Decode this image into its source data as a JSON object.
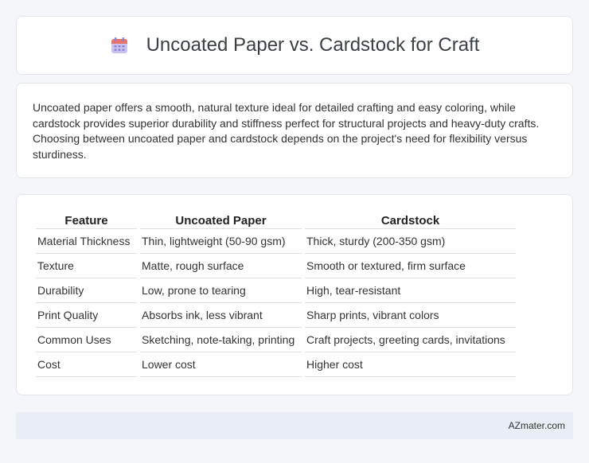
{
  "header": {
    "icon": "calendar-icon",
    "title": "Uncoated Paper vs. Cardstock for Craft"
  },
  "summary": {
    "text": "Uncoated paper offers a smooth, natural texture ideal for detailed crafting and easy coloring, while cardstock provides superior durability and stiffness perfect for structural projects and heavy-duty crafts. Choosing between uncoated paper and cardstock depends on the project's need for flexibility versus sturdiness."
  },
  "table": {
    "headers": [
      "Feature",
      "Uncoated Paper",
      "Cardstock"
    ],
    "rows": [
      [
        "Material Thickness",
        "Thin, lightweight (50-90 gsm)",
        "Thick, sturdy (200-350 gsm)"
      ],
      [
        "Texture",
        "Matte, rough surface",
        "Smooth or textured, firm surface"
      ],
      [
        "Durability",
        "Low, prone to tearing",
        "High, tear-resistant"
      ],
      [
        "Print Quality",
        "Absorbs ink, less vibrant",
        "Sharp prints, vibrant colors"
      ],
      [
        "Common Uses",
        "Sketching, note-taking, printing",
        "Craft projects, greeting cards, invitations"
      ],
      [
        "Cost",
        "Lower cost",
        "Higher cost"
      ]
    ]
  },
  "footer": {
    "text": "AZmater.com"
  },
  "colors": {
    "icon_accent": "#8b7fd6",
    "icon_top": "#e8736a",
    "footer_bg": "#e9eef6"
  }
}
